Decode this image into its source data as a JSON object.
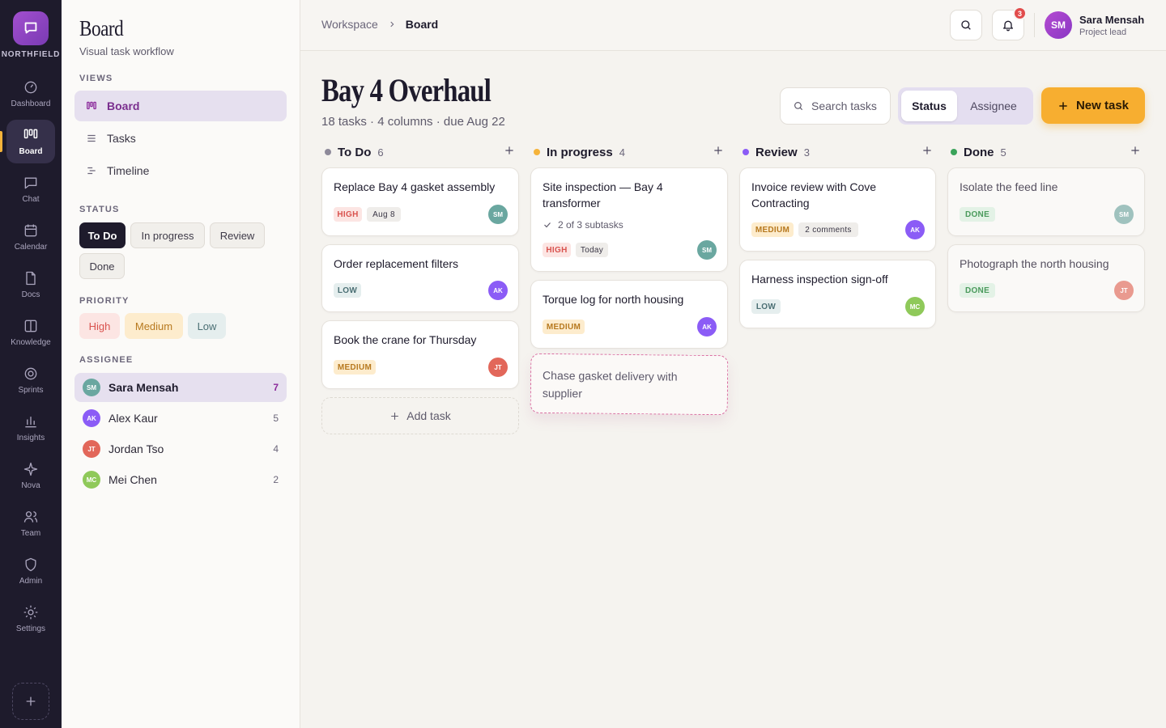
{
  "rail": {
    "brand": "NORTHFIELD",
    "items": [
      {
        "label": "Dashboard",
        "icon": "dashboard-icon"
      },
      {
        "label": "Board",
        "icon": "board-icon",
        "active": true
      },
      {
        "label": "Chat",
        "icon": "chat-icon"
      },
      {
        "label": "Calendar",
        "icon": "calendar-icon"
      },
      {
        "label": "Docs",
        "icon": "docs-icon"
      },
      {
        "label": "Knowledge",
        "icon": "knowledge-icon"
      },
      {
        "label": "Sprints",
        "icon": "sprints-icon"
      },
      {
        "label": "Insights",
        "icon": "insights-icon"
      },
      {
        "label": "Nova",
        "icon": "nova-icon"
      },
      {
        "label": "Team",
        "icon": "team-icon"
      },
      {
        "label": "Admin",
        "icon": "admin-icon"
      },
      {
        "label": "Settings",
        "icon": "settings-icon"
      }
    ]
  },
  "sidebar": {
    "title": "Board",
    "subtitle": "Visual task workflow",
    "views_label": "VIEWS",
    "views": [
      {
        "label": "Board",
        "active": true
      },
      {
        "label": "Tasks"
      },
      {
        "label": "Timeline"
      }
    ],
    "status_label": "STATUS",
    "status": [
      "To Do",
      "In progress",
      "Review",
      "Done"
    ],
    "priority_label": "PRIORITY",
    "priority": [
      "High",
      "Medium",
      "Low"
    ],
    "assignee_label": "ASSIGNEE",
    "assignees": [
      {
        "initials": "SM",
        "name": "Sara Mensah",
        "count": "7",
        "color": "#6aa7a0",
        "active": true
      },
      {
        "initials": "AK",
        "name": "Alex Kaur",
        "count": "5",
        "color": "#8b5cf6"
      },
      {
        "initials": "JT",
        "name": "Jordan Tso",
        "count": "4",
        "color": "#e2675a"
      },
      {
        "initials": "MC",
        "name": "Mei Chen",
        "count": "2",
        "color": "#8fc95a"
      }
    ]
  },
  "topbar": {
    "breadcrumb": [
      "Workspace",
      "Board"
    ],
    "notifications": "3",
    "user": {
      "initials": "SM",
      "name": "Sara Mensah",
      "role": "Project lead"
    }
  },
  "project": {
    "title": "Bay 4 Overhaul",
    "summary": "18 tasks · 4 columns · due Aug 22",
    "search_placeholder": "Search tasks",
    "group_options": [
      "Status",
      "Assignee"
    ],
    "new_task": "New task"
  },
  "columns": [
    {
      "title": "To Do",
      "count": "6",
      "color": "#8e8a9a",
      "cards": [
        {
          "title": "Replace Bay 4 gasket assembly",
          "priority": "HIGH",
          "meta": "Aug 8",
          "avatar": "SM"
        },
        {
          "title": "Order replacement filters",
          "priority": "LOW",
          "avatar": "AK"
        },
        {
          "title": "Book the crane for Thursday",
          "priority": "MEDIUM",
          "avatar": "JT"
        }
      ],
      "add_label": "Add task"
    },
    {
      "title": "In progress",
      "count": "4",
      "color": "#f5b33a",
      "cards": [
        {
          "title": "Site inspection — Bay 4 transformer",
          "subtasks": "2 of 3 subtasks",
          "priority": "HIGH",
          "meta": "Today",
          "avatar": "SM"
        },
        {
          "title": "Torque log for north housing",
          "priority": "MEDIUM",
          "avatar": "AK"
        }
      ],
      "ghost": "Chase gasket delivery with supplier"
    },
    {
      "title": "Review",
      "count": "3",
      "color": "#8b5cf6",
      "cards": [
        {
          "title": "Invoice review with Cove Contracting",
          "priority": "MEDIUM",
          "meta": "2 comments",
          "avatar": "AK"
        },
        {
          "title": "Harness inspection sign-off",
          "priority": "LOW",
          "avatar": "MC"
        }
      ]
    },
    {
      "title": "Done",
      "count": "5",
      "color": "#3aa35a",
      "cards": [
        {
          "title": "Isolate the feed line",
          "priority": "DONE",
          "avatar": "SM"
        },
        {
          "title": "Photograph the north housing",
          "priority": "DONE",
          "avatar": "JT"
        }
      ]
    }
  ]
}
